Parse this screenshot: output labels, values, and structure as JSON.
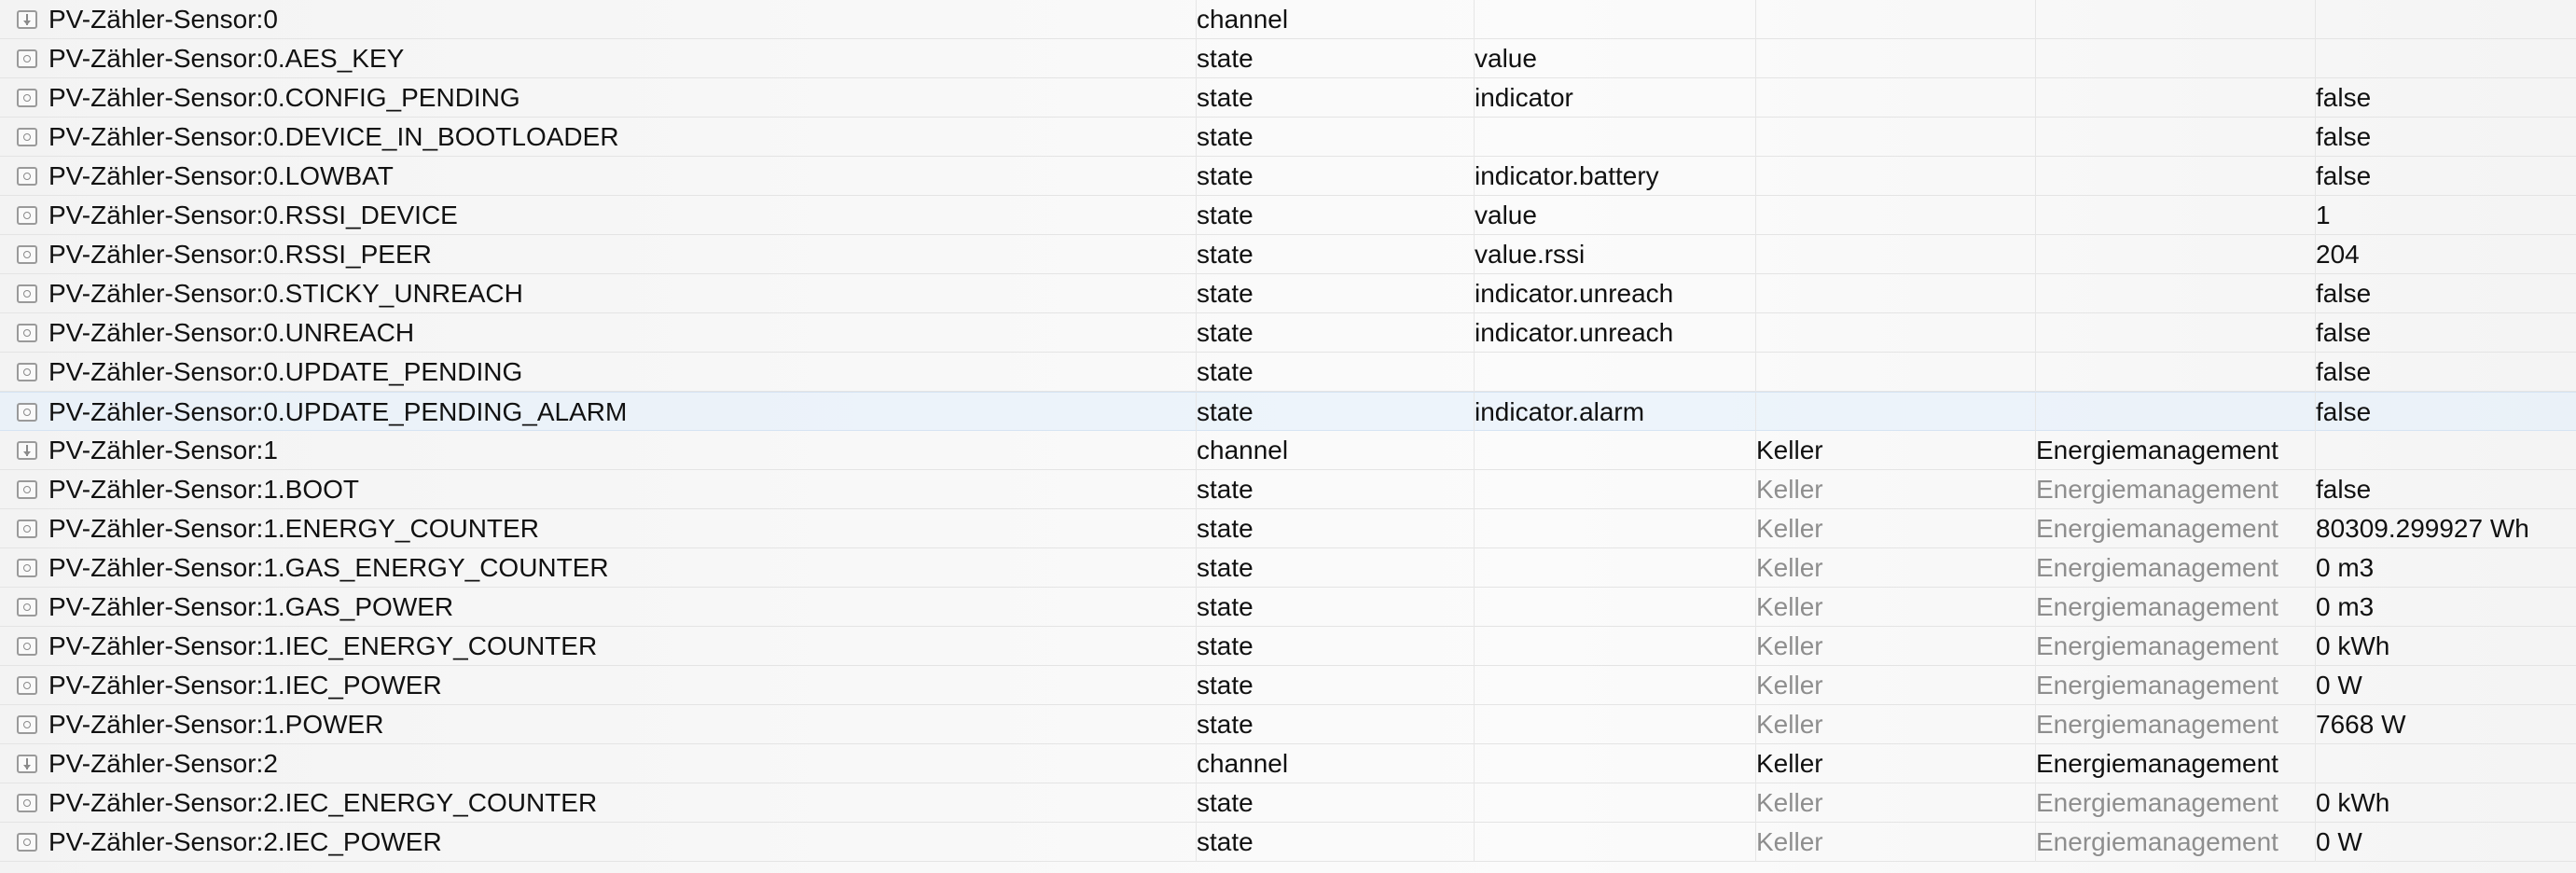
{
  "rows": [
    {
      "id": "PV-Zähler-Sensor:0",
      "type": "channel",
      "role": "",
      "room": "",
      "function": "",
      "value": "",
      "icon": "channel-icon",
      "inherited": false,
      "selected": false
    },
    {
      "id": "PV-Zähler-Sensor:0.AES_KEY",
      "type": "state",
      "role": "value",
      "room": "",
      "function": "",
      "value": "",
      "icon": "state-icon",
      "inherited": false,
      "selected": false
    },
    {
      "id": "PV-Zähler-Sensor:0.CONFIG_PENDING",
      "type": "state",
      "role": "indicator",
      "room": "",
      "function": "",
      "value": "false",
      "icon": "state-icon",
      "inherited": false,
      "selected": false
    },
    {
      "id": "PV-Zähler-Sensor:0.DEVICE_IN_BOOTLOADER",
      "type": "state",
      "role": "",
      "room": "",
      "function": "",
      "value": "false",
      "icon": "state-icon",
      "inherited": false,
      "selected": false
    },
    {
      "id": "PV-Zähler-Sensor:0.LOWBAT",
      "type": "state",
      "role": "indicator.battery",
      "room": "",
      "function": "",
      "value": "false",
      "icon": "state-icon",
      "inherited": false,
      "selected": false
    },
    {
      "id": "PV-Zähler-Sensor:0.RSSI_DEVICE",
      "type": "state",
      "role": "value",
      "room": "",
      "function": "",
      "value": "1",
      "icon": "state-icon",
      "inherited": false,
      "selected": false
    },
    {
      "id": "PV-Zähler-Sensor:0.RSSI_PEER",
      "type": "state",
      "role": "value.rssi",
      "room": "",
      "function": "",
      "value": "204",
      "icon": "state-icon",
      "inherited": false,
      "selected": false
    },
    {
      "id": "PV-Zähler-Sensor:0.STICKY_UNREACH",
      "type": "state",
      "role": "indicator.unreach",
      "room": "",
      "function": "",
      "value": "false",
      "icon": "state-icon",
      "inherited": false,
      "selected": false
    },
    {
      "id": "PV-Zähler-Sensor:0.UNREACH",
      "type": "state",
      "role": "indicator.unreach",
      "room": "",
      "function": "",
      "value": "false",
      "icon": "state-icon",
      "inherited": false,
      "selected": false
    },
    {
      "id": "PV-Zähler-Sensor:0.UPDATE_PENDING",
      "type": "state",
      "role": "",
      "room": "",
      "function": "",
      "value": "false",
      "icon": "state-icon",
      "inherited": false,
      "selected": false
    },
    {
      "id": "PV-Zähler-Sensor:0.UPDATE_PENDING_ALARM",
      "type": "state",
      "role": "indicator.alarm",
      "room": "",
      "function": "",
      "value": "false",
      "icon": "state-icon",
      "inherited": false,
      "selected": true
    },
    {
      "id": "PV-Zähler-Sensor:1",
      "type": "channel",
      "role": "",
      "room": "Keller",
      "function": "Energiemanagement",
      "value": "",
      "icon": "channel-icon",
      "inherited": false,
      "selected": false
    },
    {
      "id": "PV-Zähler-Sensor:1.BOOT",
      "type": "state",
      "role": "",
      "room": "Keller",
      "function": "Energiemanagement",
      "value": "false",
      "icon": "state-icon",
      "inherited": true,
      "selected": false
    },
    {
      "id": "PV-Zähler-Sensor:1.ENERGY_COUNTER",
      "type": "state",
      "role": "",
      "room": "Keller",
      "function": "Energiemanagement",
      "value": "80309.299927 Wh",
      "icon": "state-icon",
      "inherited": true,
      "selected": false
    },
    {
      "id": "PV-Zähler-Sensor:1.GAS_ENERGY_COUNTER",
      "type": "state",
      "role": "",
      "room": "Keller",
      "function": "Energiemanagement",
      "value": "0 m3",
      "icon": "state-icon",
      "inherited": true,
      "selected": false
    },
    {
      "id": "PV-Zähler-Sensor:1.GAS_POWER",
      "type": "state",
      "role": "",
      "room": "Keller",
      "function": "Energiemanagement",
      "value": "0 m3",
      "icon": "state-icon",
      "inherited": true,
      "selected": false
    },
    {
      "id": "PV-Zähler-Sensor:1.IEC_ENERGY_COUNTER",
      "type": "state",
      "role": "",
      "room": "Keller",
      "function": "Energiemanagement",
      "value": "0 kWh",
      "icon": "state-icon",
      "inherited": true,
      "selected": false
    },
    {
      "id": "PV-Zähler-Sensor:1.IEC_POWER",
      "type": "state",
      "role": "",
      "room": "Keller",
      "function": "Energiemanagement",
      "value": "0 W",
      "icon": "state-icon",
      "inherited": true,
      "selected": false
    },
    {
      "id": "PV-Zähler-Sensor:1.POWER",
      "type": "state",
      "role": "",
      "room": "Keller",
      "function": "Energiemanagement",
      "value": "7668 W",
      "icon": "state-icon",
      "inherited": true,
      "selected": false
    },
    {
      "id": "PV-Zähler-Sensor:2",
      "type": "channel",
      "role": "",
      "room": "Keller",
      "function": "Energiemanagement",
      "value": "",
      "icon": "channel-icon",
      "inherited": false,
      "selected": false
    },
    {
      "id": "PV-Zähler-Sensor:2.IEC_ENERGY_COUNTER",
      "type": "state",
      "role": "",
      "room": "Keller",
      "function": "Energiemanagement",
      "value": "0 kWh",
      "icon": "state-icon",
      "inherited": true,
      "selected": false
    },
    {
      "id": "PV-Zähler-Sensor:2.IEC_POWER",
      "type": "state",
      "role": "",
      "room": "Keller",
      "function": "Energiemanagement",
      "value": "0 W",
      "icon": "state-icon",
      "inherited": true,
      "selected": false
    }
  ]
}
